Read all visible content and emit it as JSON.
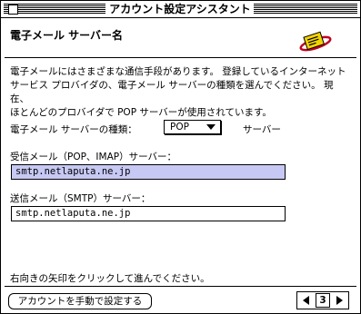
{
  "window": {
    "title": "アカウント設定アシスタント"
  },
  "header": {
    "title": "電子メール サーバー名",
    "icon": "mail-envelope-icon"
  },
  "intro": {
    "lines": [
      "電子メールにはさまざまな通信手段があります。 登録しているインターネット",
      "サービス プロバイダの、電子メール サーバーの種類を選んでください。 現在、",
      "ほとんどのプロバイダで POP サーバーが使用されています。"
    ]
  },
  "server_type": {
    "label": "電子メール サーバーの種類：",
    "selected": "POP",
    "suffix": "サーバー"
  },
  "incoming": {
    "label": "受信メール（POP、IMAP）サーバー：",
    "value": "smtp.netlaputa.ne.jp"
  },
  "outgoing": {
    "label": "送信メール（SMTP）サーバー：",
    "value": "smtp.netlaputa.ne.jp"
  },
  "footer": {
    "hint": "右向きの矢印をクリックして進んでください。",
    "manual_button": "アカウントを手動で設定する",
    "page_number": "3"
  }
}
